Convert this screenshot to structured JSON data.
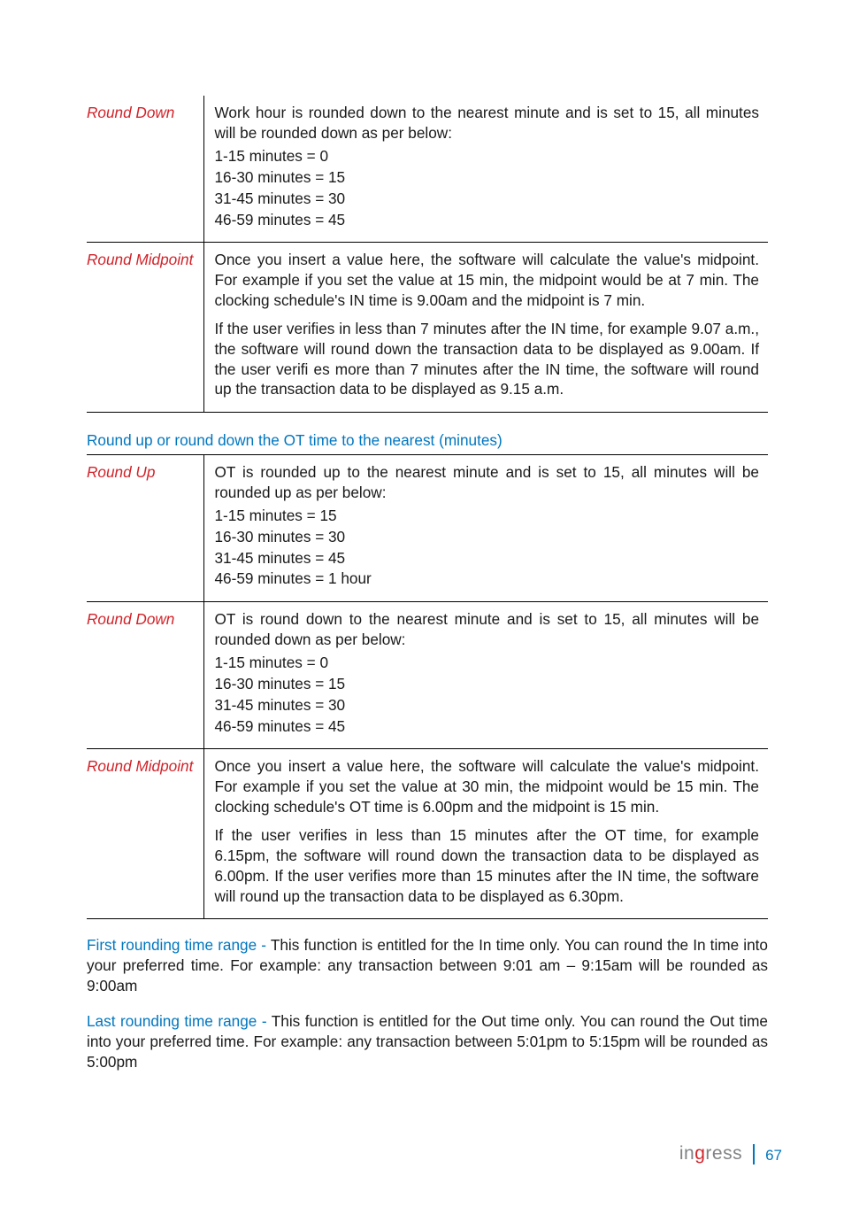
{
  "table1": {
    "rows": [
      {
        "term": "Round Down",
        "para": "Work hour is rounded down to the nearest minute and is set to 15, all minutes will be rounded down as per below:",
        "lines": [
          "1-15 minutes = 0",
          "16-30 minutes = 15",
          "31-45 minutes = 30",
          "46-59 minutes = 45"
        ],
        "para2": ""
      },
      {
        "term": "Round Midpoint",
        "para": "Once you insert a value here, the software will calculate the value's midpoint. For example if you set the value at 15 min, the midpoint would be at 7 min. The clocking schedule's IN time is 9.00am and the midpoint is 7 min.",
        "lines": [],
        "para2": "If the user verifies in less than 7 minutes after the IN time, for example 9.07 a.m., the software will round down the transaction data to be displayed as 9.00am. If the user verifi es more than 7 minutes after the IN time, the software will round up the transaction data to be displayed as 9.15 a.m."
      }
    ]
  },
  "section_heading": "Round up or round down the OT time to the nearest (minutes)",
  "table2": {
    "rows": [
      {
        "term": "Round Up",
        "para": "OT is rounded up to the nearest minute and is set to 15, all minutes will be rounded up as per below:",
        "lines": [
          "1-15 minutes = 15",
          "16-30 minutes = 30",
          "31-45 minutes = 45",
          "46-59 minutes = 1 hour"
        ],
        "para2": ""
      },
      {
        "term": "Round Down",
        "para": "OT is round down to the nearest minute and is set to 15, all minutes will be rounded down as per below:",
        "lines": [
          "1-15 minutes = 0",
          "16-30 minutes = 15",
          "31-45 minutes = 30",
          "46-59 minutes = 45"
        ],
        "para2": ""
      },
      {
        "term": "Round Midpoint",
        "para": "Once you insert a value here, the software will calculate the value's midpoint. For example if you set the value at 30 min, the midpoint would be 15 min. The clocking schedule's OT time is 6.00pm and the midpoint is 15 min.",
        "lines": [],
        "para2": "If the user verifies in less than 15 minutes after the OT time, for example 6.15pm, the software will round down the transaction data to be displayed as 6.00pm. If the user verifies more than 15 minutes after the IN time, the software will round up the transaction data to be displayed as 6.30pm."
      }
    ]
  },
  "para1": {
    "lead": "First rounding time range - ",
    "text": "This function is entitled for the In time only. You can round the In time into your preferred time. For example: any transaction between 9:01 am – 9:15am will be rounded as 9:00am"
  },
  "para2": {
    "lead": "Last rounding time range - ",
    "text": "This function is entitled for the Out time only. You can round the Out time into your preferred time. For example: any transaction between 5:01pm to 5:15pm will be rounded as 5:00pm"
  },
  "footer": {
    "brand_pre": "in",
    "brand_g": "g",
    "brand_post": "ress",
    "page": "67"
  }
}
